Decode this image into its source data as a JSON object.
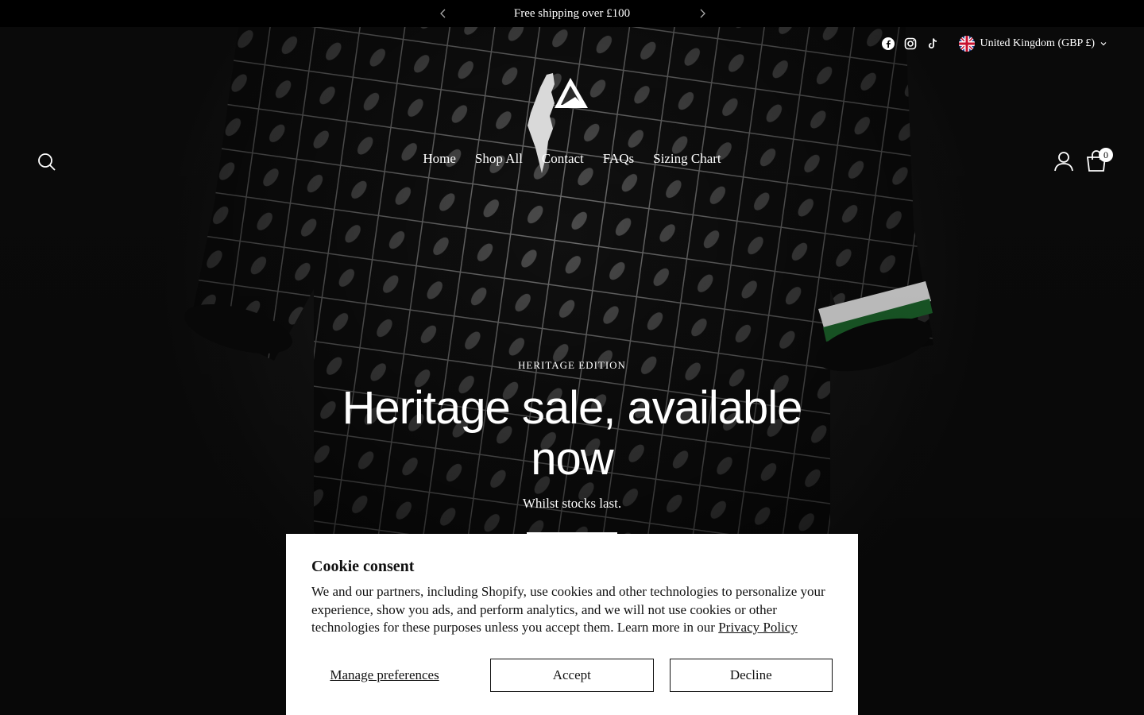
{
  "announcement": {
    "text": "Free shipping over £100",
    "prev_icon": "chevron-left-icon",
    "next_icon": "chevron-right-icon"
  },
  "header": {
    "social": [
      "facebook-icon",
      "instagram-icon",
      "tiktok-icon"
    ],
    "locale": "United Kingdom (GBP £)",
    "nav": [
      "Home",
      "Shop All",
      "Contact",
      "FAQs",
      "Sizing Chart"
    ],
    "cart_count": "0"
  },
  "hero": {
    "eyebrow": "HERITAGE EDITION",
    "headline": "Heritage sale, available now",
    "subline": "Whilst stocks last."
  },
  "cookie": {
    "title": "Cookie consent",
    "body": "We and our partners, including Shopify, use cookies and other technologies to personalize your experience, show you ads, and perform analytics, and we will not use cookies or other technologies for these purposes unless you accept them. Learn more in our ",
    "policy_link": "Privacy Policy",
    "manage": "Manage preferences",
    "accept": "Accept",
    "decline": "Decline"
  },
  "colors": {
    "background": "#000000",
    "text_light": "#ffffff",
    "panel": "#ffffff",
    "text_dark": "#111111"
  }
}
